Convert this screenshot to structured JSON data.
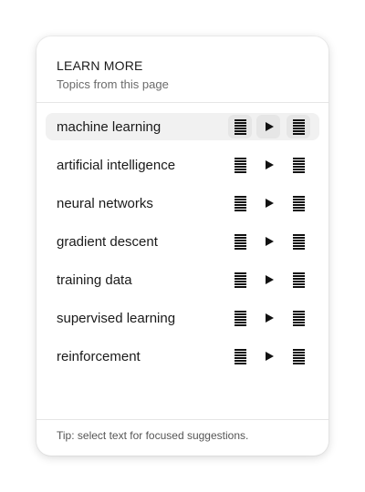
{
  "panel": {
    "title": "LEARN MORE",
    "subtitle": "Topics from this page"
  },
  "topics": [
    {
      "label": "machine learning",
      "active": true
    },
    {
      "label": "artificial intelligence",
      "active": false
    },
    {
      "label": "neural networks",
      "active": false
    },
    {
      "label": "gradient descent",
      "active": false
    },
    {
      "label": "training data",
      "active": false
    },
    {
      "label": "supervised learning",
      "active": false
    },
    {
      "label": "reinforcement",
      "active": false
    }
  ],
  "row_actions": [
    "lines-icon",
    "play-icon",
    "lines-icon"
  ],
  "footer": {
    "tip": "Tip: select text for focused suggestions."
  }
}
